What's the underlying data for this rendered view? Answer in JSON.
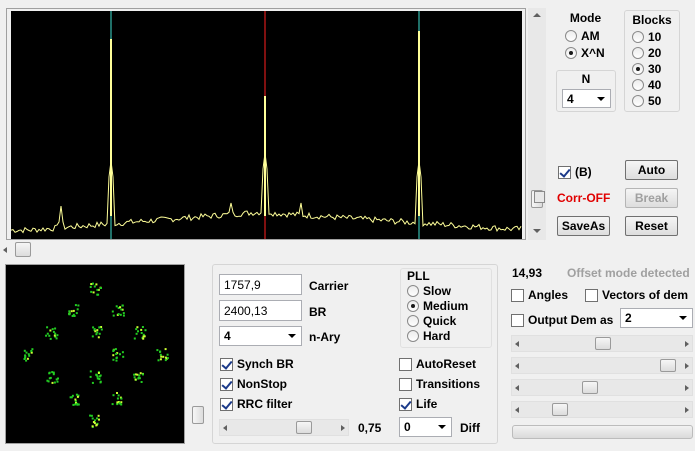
{
  "spectrum": {
    "colors": {
      "background": "#000000",
      "trace": "#ffff99",
      "center_marker": "#ff2020",
      "side_marker": "#40e0d0"
    }
  },
  "mode": {
    "title": "Mode",
    "options": [
      {
        "label": "AM",
        "selected": false
      },
      {
        "label": "X^N",
        "selected": true
      }
    ]
  },
  "blocks": {
    "title": "Blocks",
    "options": [
      {
        "label": "10",
        "selected": false
      },
      {
        "label": "20",
        "selected": false
      },
      {
        "label": "30",
        "selected": true
      },
      {
        "label": "40",
        "selected": false
      },
      {
        "label": "50",
        "selected": false
      }
    ]
  },
  "n_group": {
    "title": "N",
    "value": "4"
  },
  "right_controls": {
    "b_check": {
      "label": "(B)",
      "checked": true
    },
    "corr_label": "Corr-OFF",
    "corr_color": "#e00000",
    "auto_button": "Auto",
    "break_button": "Break",
    "saveas_button": "SaveAs",
    "reset_button": "Reset"
  },
  "params": {
    "carrier_value": "1757,9",
    "carrier_label": "Carrier",
    "br_value": "2400,13",
    "br_label": "BR",
    "nary_value": "4",
    "nary_label": "n-Ary",
    "checks": [
      {
        "label": "Synch BR",
        "checked": true
      },
      {
        "label": "NonStop",
        "checked": true
      },
      {
        "label": "RRC filter",
        "checked": true
      }
    ],
    "rolloff_value": "0,75",
    "diff_value": "0",
    "diff_label": "Diff"
  },
  "pll": {
    "title": "PLL",
    "options": [
      {
        "label": "Slow",
        "selected": false
      },
      {
        "label": "Medium",
        "selected": true
      },
      {
        "label": "Quick",
        "selected": false
      },
      {
        "label": "Hard",
        "selected": false
      }
    ],
    "checks": [
      {
        "label": "AutoReset",
        "checked": false
      },
      {
        "label": "Transitions",
        "checked": false
      },
      {
        "label": "Life",
        "checked": true
      }
    ]
  },
  "status": {
    "value": "14,93",
    "message": "Offset mode detected",
    "angles": {
      "label": "Angles",
      "checked": false
    },
    "vectors": {
      "label": "Vectors of dem",
      "checked": false
    },
    "output": {
      "label": "Output Dem as",
      "checked": false
    },
    "output_value": "2"
  },
  "constellation": {
    "colors": {
      "background": "#000000",
      "dots": "#22cc22",
      "highlight": "#ccff33"
    }
  }
}
